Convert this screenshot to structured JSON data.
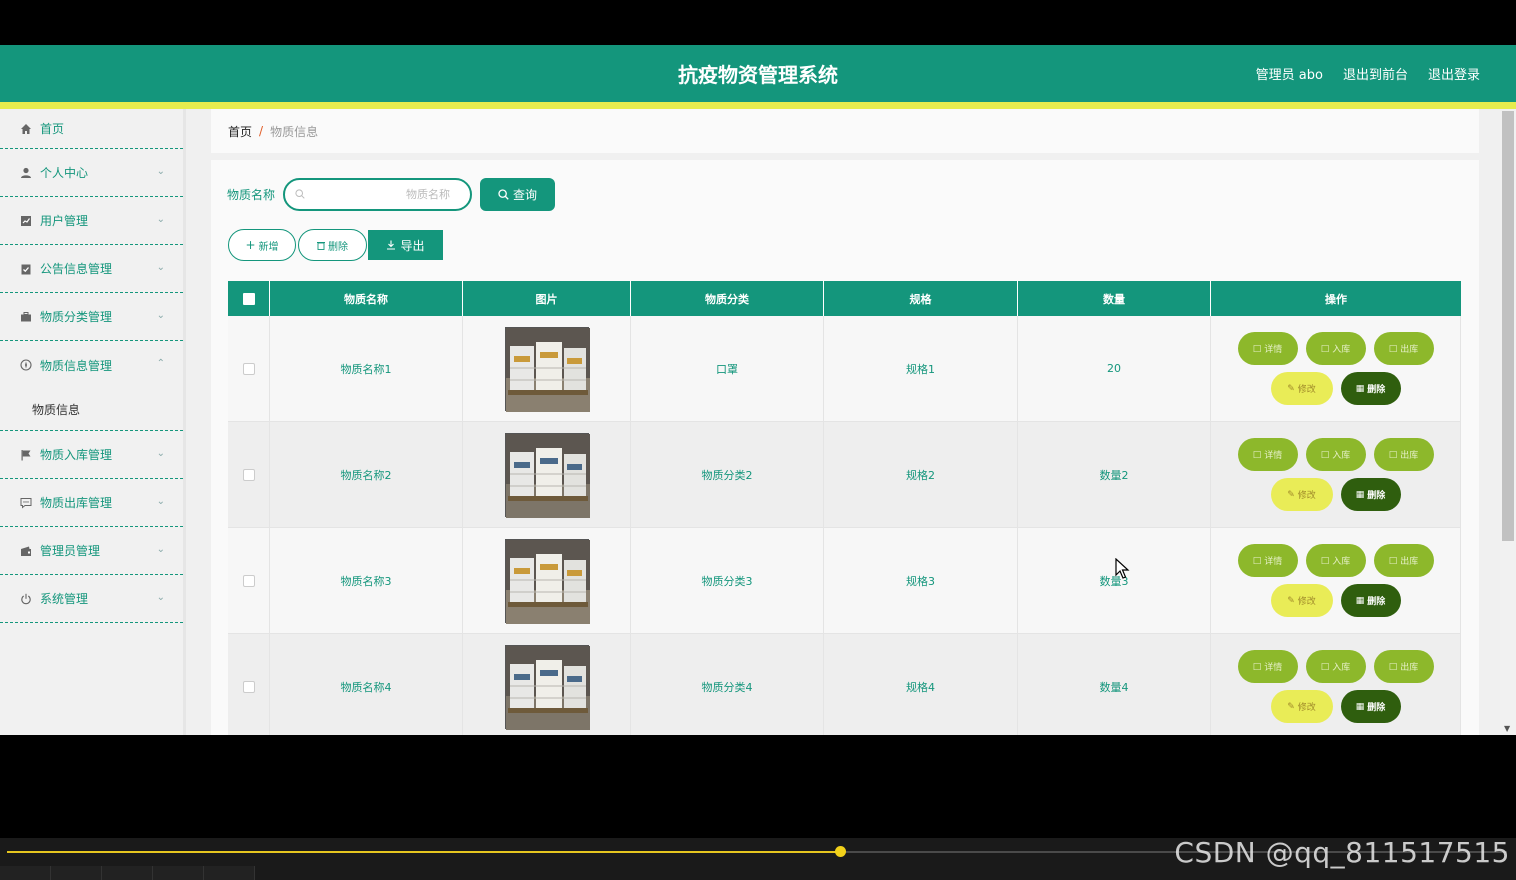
{
  "header": {
    "title": "抗疫物资管理系统",
    "user_label": "管理员 abo",
    "to_front_label": "退出到前台",
    "logout_label": "退出登录"
  },
  "sidebar": {
    "items": [
      {
        "label": "首页",
        "icon": "home-icon",
        "has_arrow": false
      },
      {
        "label": "个人中心",
        "icon": "user-icon",
        "has_arrow": true
      },
      {
        "label": "用户管理",
        "icon": "chart-icon",
        "has_arrow": true
      },
      {
        "label": "公告信息管理",
        "icon": "clipboard-icon",
        "has_arrow": true
      },
      {
        "label": "物质分类管理",
        "icon": "briefcase-icon",
        "has_arrow": true
      },
      {
        "label": "物质信息管理",
        "icon": "compass-icon",
        "has_arrow": true,
        "expanded": true
      },
      {
        "label": "物质入库管理",
        "icon": "flag-icon",
        "has_arrow": true
      },
      {
        "label": "物质出库管理",
        "icon": "message-icon",
        "has_arrow": true
      },
      {
        "label": "管理员管理",
        "icon": "wallet-icon",
        "has_arrow": true
      },
      {
        "label": "系统管理",
        "icon": "power-icon",
        "has_arrow": true
      }
    ],
    "submenu_label": "物质信息"
  },
  "breadcrumb": {
    "home": "首页",
    "separator": "/",
    "current": "物质信息"
  },
  "search": {
    "label": "物质名称",
    "placeholder": "物质名称",
    "query_label": "查询"
  },
  "actions": {
    "add_label": "新增",
    "delete_label": "删除",
    "export_label": "导出"
  },
  "table": {
    "headers": [
      "物质名称",
      "图片",
      "物质分类",
      "规格",
      "数量",
      "操作"
    ],
    "rows": [
      {
        "name": "物质名称1",
        "category": "口罩",
        "spec": "规格1",
        "quantity": "20"
      },
      {
        "name": "物质名称2",
        "category": "物质分类2",
        "spec": "规格2",
        "quantity": "数量2"
      },
      {
        "name": "物质名称3",
        "category": "物质分类3",
        "spec": "规格3",
        "quantity": "数量3"
      },
      {
        "name": "物质名称4",
        "category": "物质分类4",
        "spec": "规格4",
        "quantity": "数量4"
      }
    ],
    "op_labels": {
      "detail": "详情",
      "stock_in": "入库",
      "stock_out": "出库",
      "edit": "修改",
      "delete": "删除"
    }
  },
  "player": {
    "progress": 0.555
  },
  "watermark": "CSDN @qq_811517515",
  "colors": {
    "primary": "#14967c",
    "accent_bar": "#e6ec4e",
    "op_green": "#8db82b",
    "op_yellow": "#e9ec57",
    "op_dark": "#2f5e0e"
  }
}
